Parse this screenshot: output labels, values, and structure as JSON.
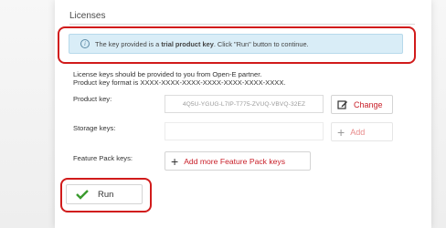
{
  "section": {
    "title": "Licenses"
  },
  "alert": {
    "text_before": "The key provided is a ",
    "text_bold": "trial product key",
    "text_after": ". Click \"Run\" button to continue."
  },
  "description": {
    "line1": "License keys should be provided to you from Open-E partner.",
    "line2": "Product key format is XXXX-XXXX-XXXX-XXXX-XXXX-XXXX-XXXX."
  },
  "product_key": {
    "label": "Product key:",
    "value": "4Q5U-YGUG-L7IP-T775-ZVUQ-VBVQ-32EZ",
    "change_label": "Change"
  },
  "storage_keys": {
    "label": "Storage keys:",
    "add_label": "Add"
  },
  "feature_pack": {
    "label": "Feature Pack keys:",
    "button_label": "Add more Feature Pack keys"
  },
  "run_button": {
    "label": "Run"
  },
  "colors": {
    "accent_red": "#c9202a",
    "highlight_red": "#d11b1b",
    "alert_bg": "#d9edf7",
    "check_green": "#3a9a2e"
  },
  "icons": {
    "alert": "info-icon",
    "change": "edit-icon",
    "add": "plus-icon",
    "feature": "plus-icon",
    "run": "checkmark-icon"
  }
}
